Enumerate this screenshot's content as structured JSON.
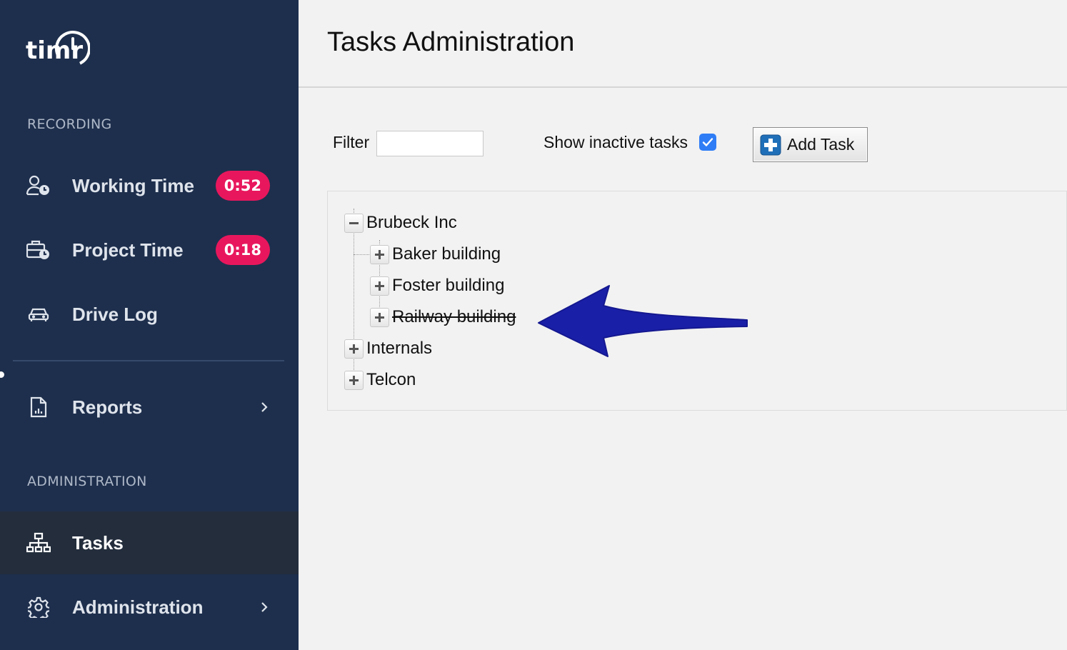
{
  "sidebar": {
    "logo_text": "timr",
    "sections": {
      "recording": "RECORDING",
      "administration": "ADMINISTRATION"
    },
    "items": [
      {
        "label": "Working Time",
        "icon": "user-clock-icon",
        "badge": "0:52"
      },
      {
        "label": "Project Time",
        "icon": "briefcase-clock-icon",
        "badge": "0:18"
      },
      {
        "label": "Drive Log",
        "icon": "car-icon"
      },
      {
        "label": "Reports",
        "icon": "report-icon"
      },
      {
        "label": "Tasks",
        "icon": "hierarchy-icon",
        "active": true
      },
      {
        "label": "Administration",
        "icon": "gear-icon"
      }
    ]
  },
  "header": {
    "title": "Tasks Administration"
  },
  "toolbar": {
    "filter_label": "Filter",
    "filter_value": "",
    "show_inactive_label": "Show inactive tasks",
    "show_inactive_checked": true,
    "add_task_label": "Add Task"
  },
  "tree": {
    "nodes": [
      {
        "label": "Brubeck Inc",
        "expanded": true,
        "children": [
          {
            "label": "Baker building",
            "expanded": false
          },
          {
            "label": "Foster building",
            "expanded": false
          },
          {
            "label": "Railway building",
            "expanded": false,
            "inactive": true
          }
        ]
      },
      {
        "label": "Internals",
        "expanded": false
      },
      {
        "label": "Telcon",
        "expanded": false
      }
    ]
  },
  "annotation": {
    "icon": "arrow-left-icon",
    "color": "#1a1fa8"
  },
  "colors": {
    "sidebar_bg": "#1e2f4d",
    "badge": "#e8175d",
    "active_item_bg": "#232d3c",
    "checkbox": "#2f7df6"
  }
}
